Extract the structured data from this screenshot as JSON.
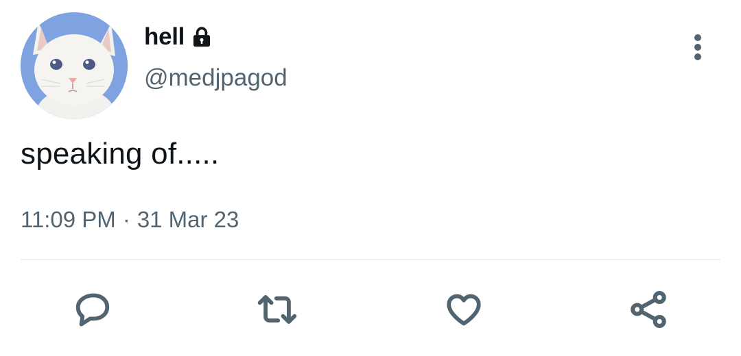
{
  "tweet": {
    "display_name": "hell",
    "handle": "@medjpagod",
    "text": "speaking of.....",
    "time": "11:09 PM",
    "separator": "·",
    "date": "31 Mar 23"
  },
  "colors": {
    "text_primary": "#0f1419",
    "text_secondary": "#536471",
    "divider": "#eff3f4",
    "avatar_background": "#7ea3e0"
  },
  "icons": {
    "account": "lock-icon",
    "more": "more-vertical-icon",
    "reply": "reply-icon",
    "retweet": "retweet-icon",
    "like": "heart-icon",
    "share": "share-icon"
  }
}
